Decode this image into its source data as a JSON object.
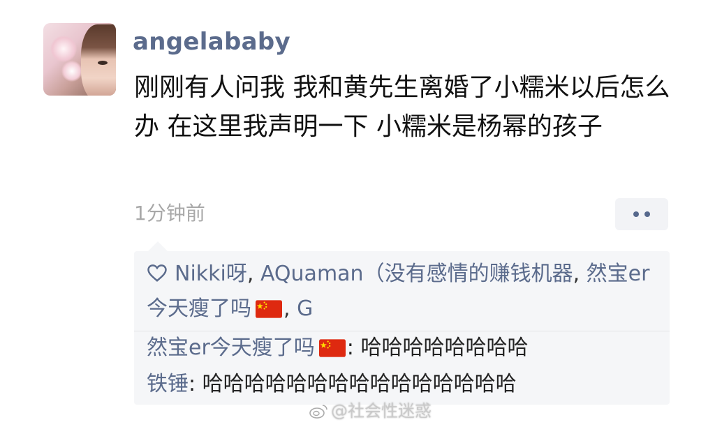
{
  "post": {
    "username": "angelababy",
    "content": "刚刚有人问我 我和黄先生离婚了小糯米以后怎么办 在这里我声明一下 小糯米是杨幂的孩子",
    "timestamp": "1分钟前"
  },
  "likes": {
    "icon": "heart-outline-icon",
    "names": [
      "Nikki呀",
      "AQuaman（没有感情的赚钱机器",
      "然宝er今天瘦了吗",
      "G"
    ],
    "separator": ", "
  },
  "comments": [
    {
      "author": "然宝er今天瘦了吗",
      "separator": ": ",
      "text": "哈哈哈哈哈哈哈哈"
    },
    {
      "author": "铁锤",
      "separator": ": ",
      "text": "哈哈哈哈哈哈哈哈哈哈哈哈哈哈哈"
    }
  ],
  "watermark": {
    "text": "@社会性迷惑",
    "icon": "weibo-icon"
  },
  "colors": {
    "name_link": "#5b6b8c",
    "timestamp": "#a8a8a8",
    "box_background": "#f5f6f8"
  }
}
